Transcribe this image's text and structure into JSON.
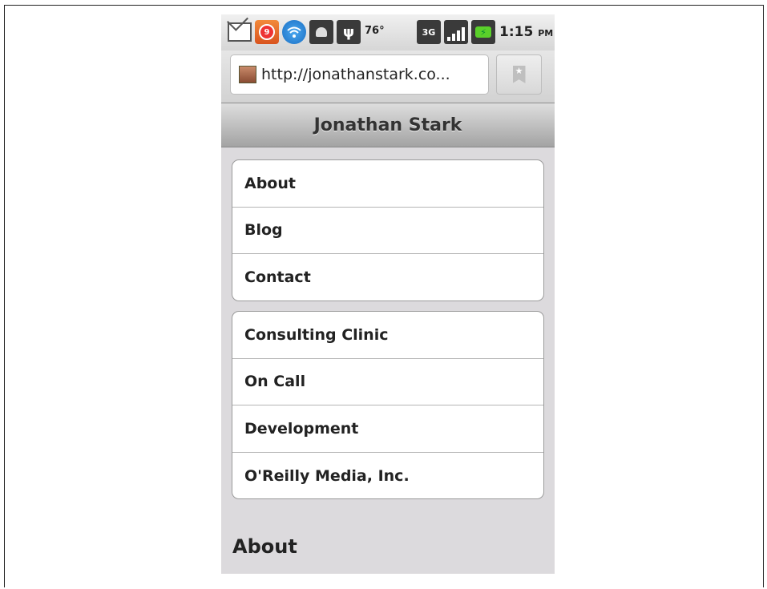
{
  "statusbar": {
    "icons": [
      "gmail-icon",
      "notification-badge-icon",
      "wifi-icon",
      "android-icon",
      "usb-icon",
      "3g-icon",
      "signal-icon",
      "battery-icon"
    ],
    "badge_count": "9",
    "usb_glyph": "ψ",
    "network_label": "3G",
    "temperature": "76°",
    "time": "1:15",
    "ampm": "PM"
  },
  "browser": {
    "url": "http://jonathanstark.co..."
  },
  "page": {
    "title": "Jonathan Stark",
    "groups": [
      {
        "items": [
          "About",
          "Blog",
          "Contact"
        ]
      },
      {
        "items": [
          "Consulting Clinic",
          "On Call",
          "Development",
          "O'Reilly Media, Inc."
        ]
      }
    ],
    "section_heading": "About"
  }
}
